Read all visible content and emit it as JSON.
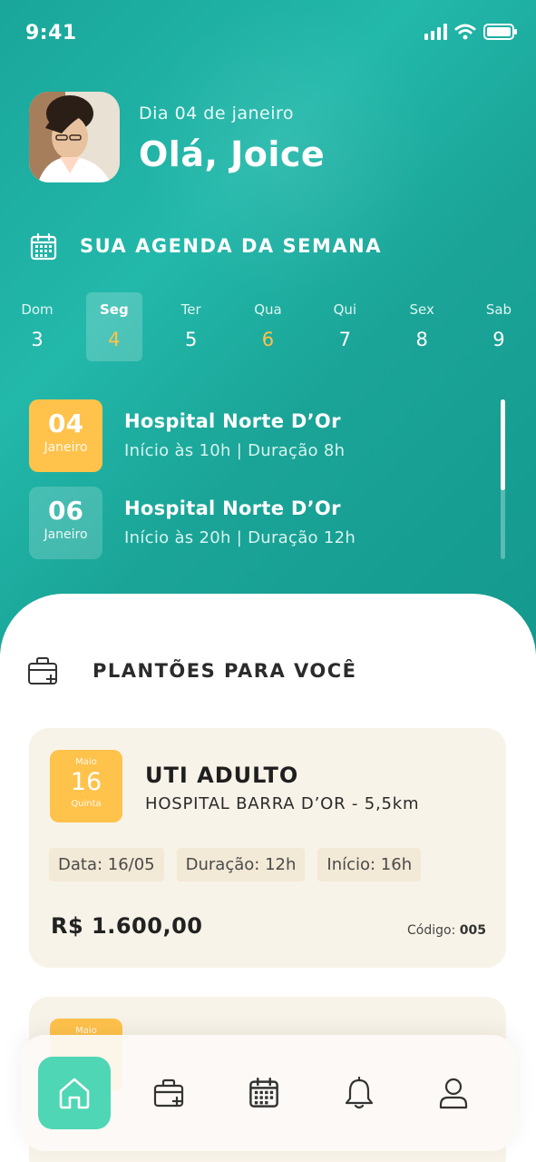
{
  "status_bar": {
    "time": "9:41"
  },
  "header": {
    "date_text": "Dia 04 de janeiro",
    "greeting": "Olá, Joice"
  },
  "agenda": {
    "title": "SUA AGENDA DA SEMANA",
    "days": [
      {
        "name": "Dom",
        "number": "3"
      },
      {
        "name": "Seg",
        "number": "4"
      },
      {
        "name": "Ter",
        "number": "5"
      },
      {
        "name": "Qua",
        "number": "6"
      },
      {
        "name": "Qui",
        "number": "7"
      },
      {
        "name": "Sex",
        "number": "8"
      },
      {
        "name": "Sab",
        "number": "9"
      }
    ],
    "shifts": [
      {
        "day": "04",
        "month": "Janeiro",
        "hospital": "Hospital Norte D’Or",
        "info": "Início às 10h | Duração 8h"
      },
      {
        "day": "06",
        "month": "Janeiro",
        "hospital": "Hospital Norte D’Or",
        "info": "Início às 20h | Duração 12h"
      }
    ]
  },
  "offers": {
    "title": "PLANTÕES PARA VOCÊ",
    "cards": [
      {
        "month": "Maio",
        "day": "16",
        "weekday": "Quinta",
        "title": "UTI ADULTO",
        "subtitle": "HOSPITAL BARRA D’OR - 5,5km",
        "chips": [
          "Data: 16/05",
          "Duração: 12h",
          "Início: 16h"
        ],
        "price": "R$ 1.600,00",
        "code_label": "Código:",
        "code_value": "005"
      },
      {
        "month": "Maio"
      }
    ]
  },
  "nav": {
    "items": [
      {
        "icon": "home-icon"
      },
      {
        "icon": "medical-kit-icon"
      },
      {
        "icon": "calendar-icon"
      },
      {
        "icon": "bell-icon"
      },
      {
        "icon": "user-icon"
      }
    ]
  },
  "colors": {
    "teal": "#1aa69a",
    "yellow": "#ffc24b",
    "nav_active": "#4fd6b4",
    "card_bg": "#f8f3e8"
  }
}
